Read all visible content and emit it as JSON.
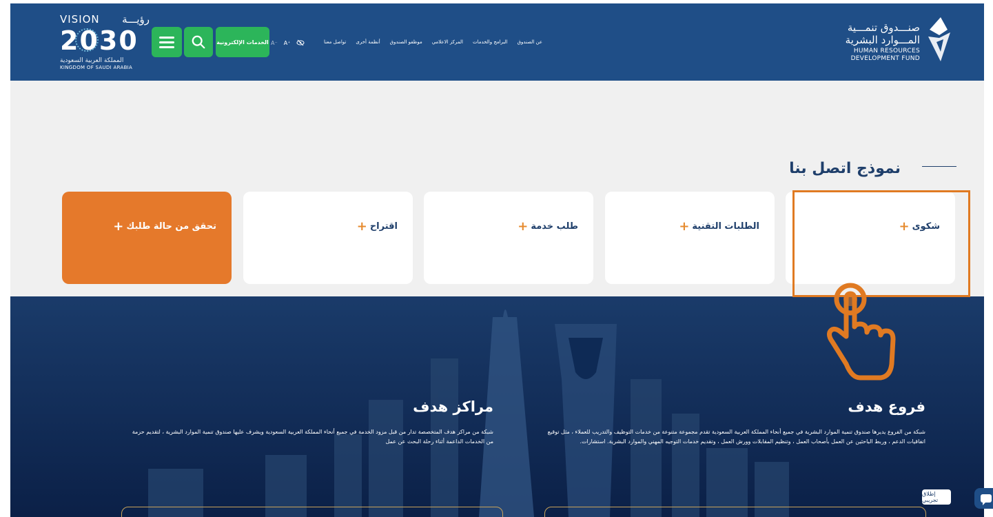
{
  "header": {
    "vision": {
      "vision_en": "VISION",
      "vision_ar": "رؤيـــة",
      "year": "2030",
      "kingdom_ar": "المملكة العربية السعودية",
      "kingdom_en": "KINGDOM OF SAUDI ARABIA"
    },
    "menu_icon": "hamburger-icon",
    "search_icon": "search-icon",
    "eservices_label": "الخدمات الإلكترونية",
    "accessibility": {
      "font_decrease": "A⁻",
      "font_increase": "A⁺",
      "contrast_icon": "eye-slash-icon"
    },
    "nav": [
      "عن الصندوق",
      "البرامج والخدمات",
      "المركز الاعلامي",
      "موظفو الصندوق",
      "أنظمة أخرى",
      "تواصل معنا"
    ],
    "fund": {
      "name_ar_1": "صنـــدوق تنمـــية",
      "name_ar_2": "المـــوارد البشرية",
      "name_en_1": "HUMAN RESOURCES",
      "name_en_2": "DEVELOPMENT FUND"
    }
  },
  "contact": {
    "title": "نموذج اتصل بنا",
    "plus": "+",
    "cards": [
      {
        "label": "شكوى"
      },
      {
        "label": "الطلبات التقنية"
      },
      {
        "label": "طلب خدمة"
      },
      {
        "label": "اقتراح"
      },
      {
        "label": "تحقق من حالة طلبك"
      }
    ]
  },
  "bottom": {
    "branches_title": "فروع هدف",
    "branches_text": "شبكة من الفروع يديرها صندوق تنمية الموارد البشرية في جميع أنحاء المملكة العربية السعودية تقدم مجموعة متنوعة من خدمات التوظيف والتدريب للعملاء ، مثل توقيع اتفاقيات الدعم ، وربط الباحثين عن العمل بأصحاب العمل ، وتنظيم المقابلات وورش العمل ، وتقديم خدمات التوجيه المهني والموارد البشرية. استشارات.",
    "centers_title": "مراكز هدف",
    "centers_text": "شبكة من مراكز هدف المتخصصة تدار من قبل مزود الخدمة في جميع أنحاء المملكة العربية السعودية ويشرف عليها صندوق تنمية الموارد البشرية ، لتقديم حزمة من الخدمات الداعمة أثناء رحلة البحث عن عمل"
  },
  "trial_label": "إطلاق تجريبي",
  "chat_icon": "chat-bubble-icon",
  "colors": {
    "header_bg": "#1f4e87",
    "green": "#2cb55a",
    "orange": "#e5792b",
    "highlight": "#e07a22",
    "dark_bg": "#0e2a55",
    "title_text": "#1f3f6b"
  }
}
